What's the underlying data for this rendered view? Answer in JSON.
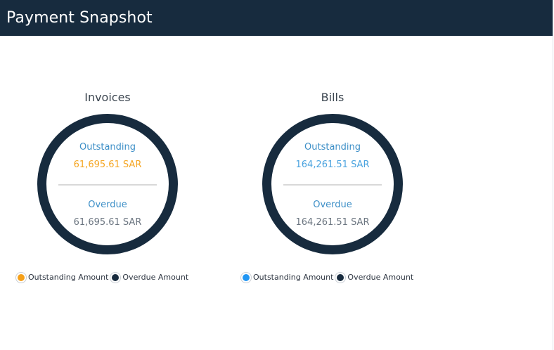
{
  "header": {
    "title": "Payment Snapshot"
  },
  "colors": {
    "header_bg": "#172b3e",
    "ring": "#172b3e",
    "label": "#3d8fc7",
    "invoice_outstanding": "#f5a623",
    "bill_outstanding": "#4aa3df",
    "overdue_value": "#6b7580",
    "legend_orange": "#f5a01a",
    "legend_blue": "#2196f3",
    "legend_dark": "#172b3e"
  },
  "invoices": {
    "title": "Invoices",
    "outstanding_label": "Outstanding",
    "outstanding_value": "61,695.61 SAR",
    "overdue_label": "Overdue",
    "overdue_value": "61,695.61 SAR",
    "legend": {
      "outstanding": "Outstanding Amount",
      "overdue": "Overdue Amount"
    }
  },
  "bills": {
    "title": "Bills",
    "outstanding_label": "Outstanding",
    "outstanding_value": "164,261.51 SAR",
    "overdue_label": "Overdue",
    "overdue_value": "164,261.51 SAR",
    "legend": {
      "outstanding": "Outstanding Amount",
      "overdue": "Overdue Amount"
    }
  }
}
